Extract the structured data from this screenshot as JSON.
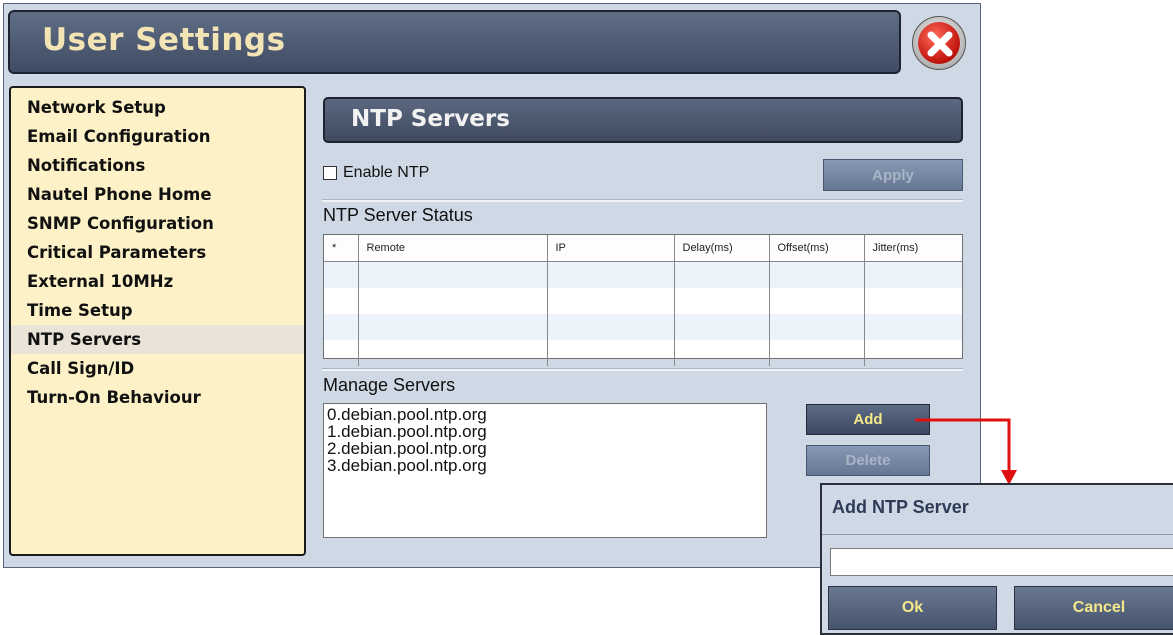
{
  "window": {
    "title": "User Settings"
  },
  "menu": {
    "items": [
      {
        "label": "Network Setup"
      },
      {
        "label": "Email Configuration"
      },
      {
        "label": "Notifications"
      },
      {
        "label": "Nautel Phone Home"
      },
      {
        "label": "SNMP Configuration"
      },
      {
        "label": "Critical Parameters"
      },
      {
        "label": "External 10MHz"
      },
      {
        "label": "Time Setup"
      },
      {
        "label": "NTP Servers"
      },
      {
        "label": "Call Sign/ID"
      },
      {
        "label": "Turn-On Behaviour"
      }
    ],
    "selected": "NTP Servers"
  },
  "section": {
    "title": "NTP Servers",
    "enable_label": "Enable NTP",
    "enable_checked": false,
    "apply_label": "Apply"
  },
  "status": {
    "label": "NTP Server Status",
    "columns": [
      "*",
      "Remote",
      "IP",
      "Delay(ms)",
      "Offset(ms)",
      "Jitter(ms)"
    ]
  },
  "manage": {
    "label": "Manage Servers",
    "servers": [
      "0.debian.pool.ntp.org",
      "1.debian.pool.ntp.org",
      "2.debian.pool.ntp.org",
      "3.debian.pool.ntp.org"
    ],
    "add_label": "Add",
    "delete_label": "Delete"
  },
  "dialog": {
    "title": "Add NTP Server",
    "input_value": "",
    "ok_label": "Ok",
    "cancel_label": "Cancel"
  },
  "colors": {
    "title_text": "#f2e4b4",
    "button_text": "#f4e98a",
    "menu_bg": "#fdf2c7",
    "panel_bg": "#cfd9e6",
    "annotation_arrow": "#e01010"
  },
  "icons": {
    "close": "close-x-icon",
    "arrow": "annotation-arrow"
  }
}
